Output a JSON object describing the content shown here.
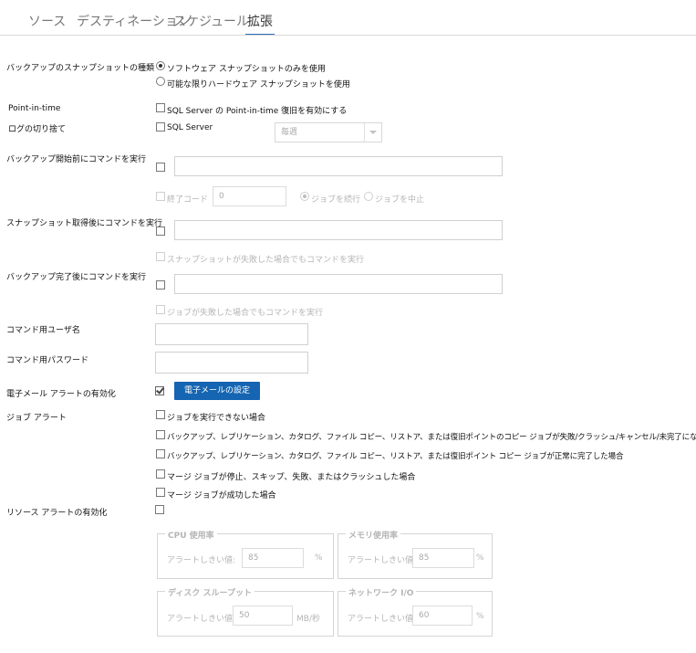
{
  "tabs": [
    {
      "label": "ソース"
    },
    {
      "label": "デスティネーション"
    },
    {
      "label": "スケジュール"
    },
    {
      "label": "拡張"
    }
  ],
  "snapshot": {
    "label": "バックアップのスナップショットの種類",
    "option_software": "ソフトウェア スナップショットのみを使用",
    "option_hardware": "可能な限りハードウェア スナップショットを使用"
  },
  "pit": {
    "label": "Point-in-time",
    "checkbox": "SQL Server の Point-in-time 復旧を有効にする"
  },
  "log_truncate": {
    "label": "ログの切り捨て",
    "checkbox": "SQL Server",
    "frequency": "毎週"
  },
  "pre_backup": {
    "label": "バックアップ開始前にコマンドを実行",
    "exit_code_label": "終了コード",
    "exit_code_value": "0",
    "continue_job": "ジョブを続行",
    "abort_job": "ジョブを中止"
  },
  "post_snapshot": {
    "label": "スナップショット取得後にコマンドを実行",
    "run_even_if_fail": "スナップショットが失敗した場合でもコマンドを実行"
  },
  "post_backup": {
    "label": "バックアップ完了後にコマンドを実行",
    "run_even_if_fail": "ジョブが失敗した場合でもコマンドを実行"
  },
  "command_user": {
    "label": "コマンド用ユーザ名"
  },
  "command_password": {
    "label": "コマンド用パスワード"
  },
  "email": {
    "label": "電子メール アラートの有効化",
    "button": "電子メールの設定"
  },
  "job_alerts": {
    "label": "ジョブ アラート",
    "items": [
      "ジョブを実行できない場合",
      "バックアップ、レプリケーション、カタログ、ファイル コピー、リストア、または復旧ポイントのコピー ジョブが失敗/クラッシュ/キャンセル/未完了になった場合",
      "バックアップ、レプリケーション、カタログ、ファイル コピー、リストア、または復旧ポイント コピー ジョブが正常に完了した場合",
      "マージ ジョブが停止、スキップ、失敗、またはクラッシュした場合",
      "マージ ジョブが成功した場合"
    ]
  },
  "resource_alerts": {
    "label": "リソース アラートの有効化",
    "threshold_label": "アラートしきい値:",
    "cpu": {
      "title": "CPU 使用率",
      "value": "85",
      "unit": "%"
    },
    "memory": {
      "title": "メモリ使用率",
      "value": "85",
      "unit": "%"
    },
    "disk": {
      "title": "ディスク スループット",
      "value": "50",
      "unit": "MB/秒"
    },
    "network": {
      "title": "ネットワーク I/O",
      "value": "60",
      "unit": "%"
    }
  }
}
